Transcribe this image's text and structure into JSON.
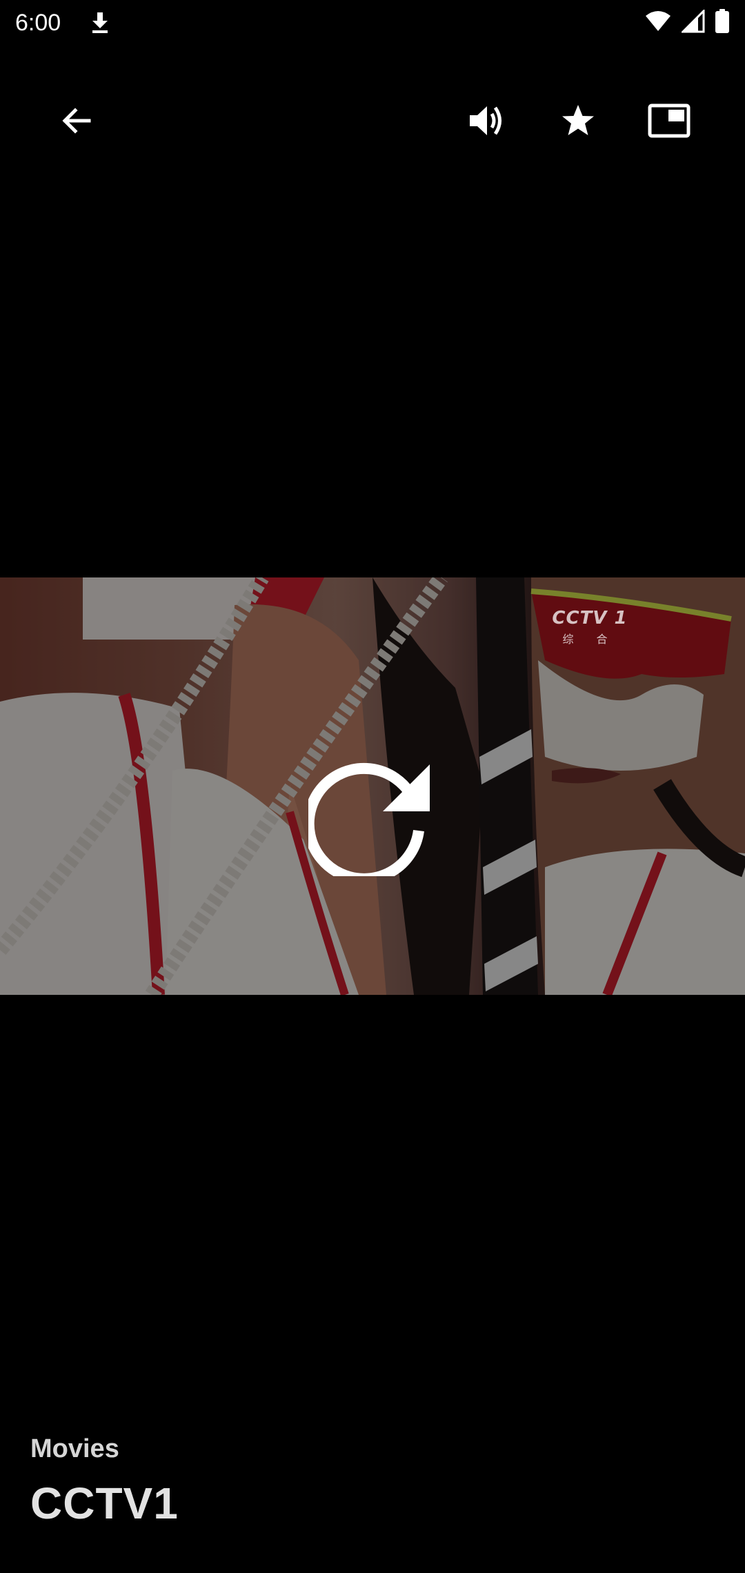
{
  "status_bar": {
    "time": "6:00",
    "icons": [
      "download-icon",
      "wifi-icon",
      "signal-icon",
      "battery-icon"
    ]
  },
  "toolbar": {
    "icons": [
      "back-arrow-icon",
      "volume-icon",
      "star-icon",
      "picture-in-picture-icon"
    ]
  },
  "video": {
    "watermark_main": "CCTV 1",
    "watermark_sub": "综 合",
    "overlay_icon": "replay-icon"
  },
  "info": {
    "category": "Movies",
    "title": "CCTV1"
  },
  "colors": {
    "background": "#000000",
    "icon": "#ffffff",
    "text": "#e2e2e2"
  }
}
